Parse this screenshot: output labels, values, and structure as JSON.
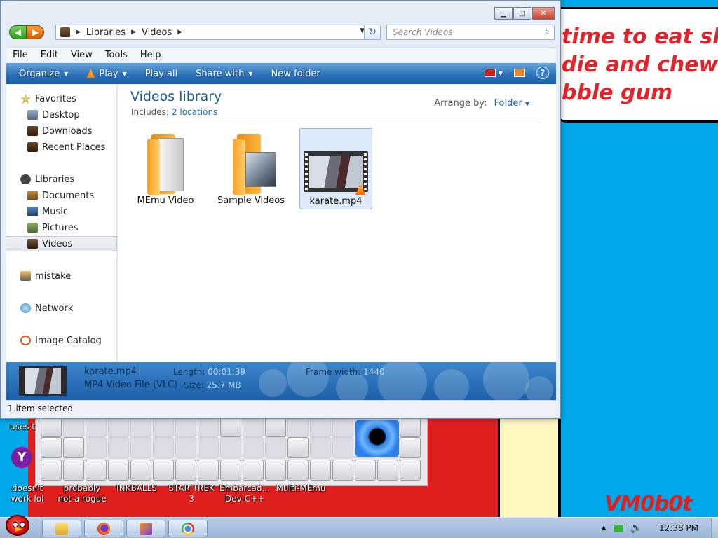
{
  "wallpaper": {
    "speech_lines": [
      "time to eat shit",
      "die and chew",
      "bble gum"
    ],
    "signature": "VM0b0t"
  },
  "desktop_icons": [
    {
      "label": "uses t"
    },
    {
      "label": "doesn't work lol"
    },
    {
      "label": "probably not a rogue"
    },
    {
      "label": "INKBALLS"
    },
    {
      "label": "STAR TREK 3"
    },
    {
      "label": "Embarcad... Dev-C++"
    },
    {
      "label": "Multi-MEmu"
    }
  ],
  "window": {
    "caption_buttons": {
      "minimize": "▁",
      "maximize": "□",
      "close": "✕"
    },
    "address": {
      "crumbs": [
        "Libraries",
        "Videos"
      ]
    },
    "search": {
      "placeholder": "Search Videos"
    },
    "menu": [
      "File",
      "Edit",
      "View",
      "Tools",
      "Help"
    ],
    "commands": {
      "organize": "Organize",
      "play": "Play",
      "play_all": "Play all",
      "share_with": "Share with",
      "new_folder": "New folder",
      "help": "?"
    },
    "nav": {
      "favorites": "Favorites",
      "desktop": "Desktop",
      "downloads": "Downloads",
      "recent": "Recent Places",
      "libraries": "Libraries",
      "documents": "Documents",
      "music": "Music",
      "pictures": "Pictures",
      "videos": "Videos",
      "mistake": "mistake",
      "network": "Network",
      "image_catalog": "Image Catalog"
    },
    "library": {
      "title": "Videos library",
      "includes_label": "Includes:",
      "includes_link": "2 locations",
      "arrange_label": "Arrange by:",
      "arrange_value": "Folder"
    },
    "items": [
      {
        "name": "MEmu Video",
        "type": "folder"
      },
      {
        "name": "Sample Videos",
        "type": "folder"
      },
      {
        "name": "karate.mp4",
        "type": "video",
        "selected": true
      }
    ],
    "details": {
      "name": "karate.mp4",
      "type": "MP4 Video File (VLC)",
      "length_label": "Length:",
      "length_value": "00:01:39",
      "size_label": "Size:",
      "size_value": "25.7 MB",
      "frame_label": "Frame width:",
      "frame_value": "1440"
    },
    "status": "1 item selected"
  },
  "taskbar": {
    "clock": "12:38 PM"
  },
  "colors": {
    "desktop": "#00a8e8",
    "command_bar": "#2d73b9",
    "accent_link": "#1b6ac9",
    "library_title": "#1e5c8a"
  }
}
